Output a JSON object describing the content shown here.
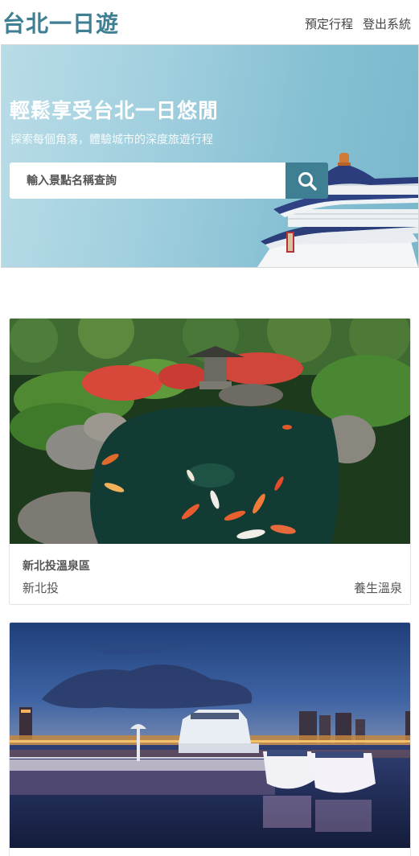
{
  "header": {
    "logo": "台北一日遊",
    "nav": [
      {
        "label": "預定行程"
      },
      {
        "label": "登出系統"
      }
    ]
  },
  "hero": {
    "title": "輕鬆享受台北一日悠閒",
    "subtitle": "探索每個角落，體驗城市的深度旅遊行程",
    "search": {
      "placeholder": "輸入景點名稱查詢",
      "button_icon": "search-icon"
    }
  },
  "attractions": [
    {
      "name": "新北投溫泉區",
      "location": "新北投",
      "category": "養生溫泉",
      "image": "koi-pond-garden"
    },
    {
      "name": "",
      "location": "",
      "category": "",
      "image": "riverside-pier-at-dusk"
    }
  ],
  "colors": {
    "brand": "#3f7f94",
    "hero_gradient_start": "#b9dce7",
    "hero_gradient_end": "#7ab7cc"
  }
}
